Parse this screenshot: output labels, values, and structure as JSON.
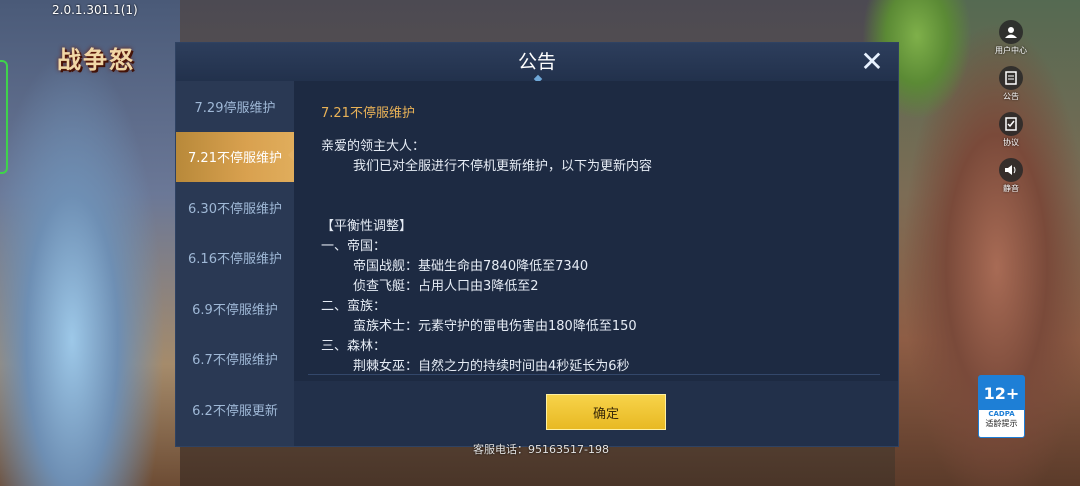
{
  "version": "2.0.1.301.1(1)",
  "logo_text": "战争怒",
  "side_menu": [
    {
      "icon": "user-icon",
      "label": "用户中心"
    },
    {
      "icon": "notice-icon",
      "label": "公告"
    },
    {
      "icon": "agreement-icon",
      "label": "协议"
    },
    {
      "icon": "sound-icon",
      "label": "静音"
    }
  ],
  "dialog": {
    "title": "公告",
    "close_glyph": "✕",
    "tabs": [
      "7.29停服维护",
      "7.21不停服维护",
      "6.30不停服维护",
      "6.16不停服维护",
      "6.9不停服维护",
      "6.7不停服维护",
      "6.2不停服更新"
    ],
    "active_tab": 1,
    "notice_title": "7.21不停服维护",
    "lines": [
      "亲爱的领主大人：",
      "我们已对全服进行不停机更新维护，以下为更新内容",
      "",
      "",
      "【平衡性调整】",
      "一、帝国：",
      "帝国战舰：基础生命由7840降低至7340",
      "侦查飞艇：占用人口由3降低至2",
      "二、蛮族：",
      "蛮族术士：元素守护的雷电伤害由180降低至150",
      "三、森林：",
      "荆棘女巫：自然之力的持续时间由4秒延长为6秒"
    ],
    "confirm_label": "确定"
  },
  "phone": "客服电话：95163517-198",
  "age_rating": {
    "rating": "12+",
    "org": "CADPA",
    "tip": "适龄提示"
  },
  "colors": {
    "accent": "#e9b257",
    "confirm": "#f2c93a",
    "dialog_bg": "#22304a"
  }
}
